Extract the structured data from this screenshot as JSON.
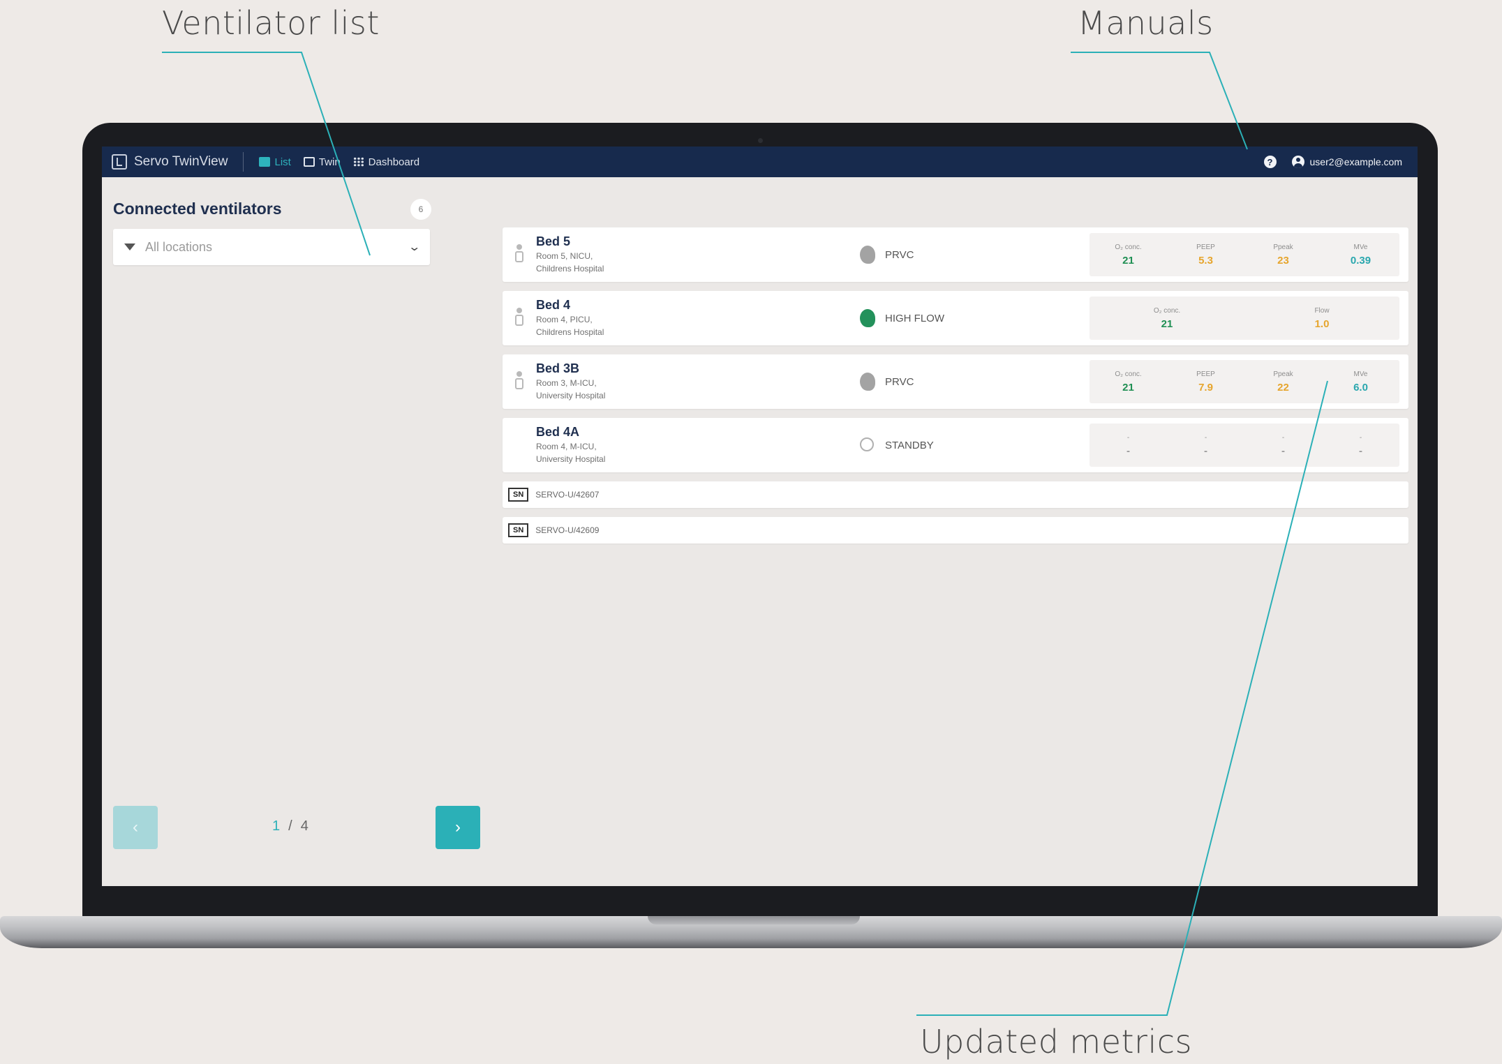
{
  "annotations": {
    "ventilator_list": "Ventilator list",
    "manuals": "Manuals",
    "updated_metrics": "Updated metrics"
  },
  "topbar": {
    "app_name": "Servo TwinView",
    "nav": [
      {
        "label": "List",
        "icon": "list-icon",
        "active": true
      },
      {
        "label": "Twin",
        "icon": "twin-icon",
        "active": false
      },
      {
        "label": "Dashboard",
        "icon": "dashboard-icon",
        "active": false
      }
    ],
    "help_icon": "help-icon",
    "user_email": "user2@example.com"
  },
  "sidebar": {
    "title": "Connected ventilators",
    "count": "6",
    "location_filter": "All locations",
    "pagination": {
      "prev": "‹",
      "current": "1",
      "separator": "/",
      "total": "4",
      "next": "›"
    }
  },
  "ventilators": [
    {
      "bed": "Bed 5",
      "room": "Room 5, NICU,",
      "hospital": "Childrens Hospital",
      "mode": "PRVC",
      "mode_icon": "neonate-head-icon",
      "mode_color": "gray",
      "metrics": [
        {
          "label": "O₂ conc.",
          "value": "21",
          "color": "green"
        },
        {
          "label": "PEEP",
          "value": "5.3",
          "color": "orange"
        },
        {
          "label": "Ppeak",
          "value": "23",
          "color": "orange"
        },
        {
          "label": "MVe",
          "value": "0.39",
          "color": "teal"
        }
      ]
    },
    {
      "bed": "Bed 4",
      "room": "Room 4, PICU,",
      "hospital": "Childrens Hospital",
      "mode": "HIGH FLOW",
      "mode_icon": "child-head-icon",
      "mode_color": "green",
      "metrics": [
        {
          "label": "O₂ conc.",
          "value": "21",
          "color": "green"
        },
        {
          "label": "Flow",
          "value": "1.0",
          "color": "orange"
        }
      ]
    },
    {
      "bed": "Bed 3B",
      "room": "Room 3, M-ICU,",
      "hospital": "University Hospital",
      "mode": "PRVC",
      "mode_icon": "adult-head-icon",
      "mode_color": "gray",
      "metrics": [
        {
          "label": "O₂ conc.",
          "value": "21",
          "color": "green"
        },
        {
          "label": "PEEP",
          "value": "7.9",
          "color": "orange"
        },
        {
          "label": "Ppeak",
          "value": "22",
          "color": "orange"
        },
        {
          "label": "MVe",
          "value": "6.0",
          "color": "teal"
        }
      ]
    },
    {
      "bed": "Bed 4A",
      "room": "Room 4, M-ICU,",
      "hospital": "University Hospital",
      "mode": "STANDBY",
      "mode_icon": "power-icon",
      "mode_color": "power",
      "metrics": [
        {
          "label": "-",
          "value": "-",
          "color": "gray"
        },
        {
          "label": "-",
          "value": "-",
          "color": "gray"
        },
        {
          "label": "-",
          "value": "-",
          "color": "gray"
        },
        {
          "label": "-",
          "value": "-",
          "color": "gray"
        }
      ]
    }
  ],
  "serial_devices": [
    {
      "badge": "SN",
      "serial": "SERVO-U/42607"
    },
    {
      "badge": "SN",
      "serial": "SERVO-U/42609"
    }
  ],
  "colors": {
    "navy": "#172a4d",
    "teal": "#2bb0b7",
    "green": "#1f8f53",
    "orange": "#e6a52d",
    "background": "#eeeae7"
  }
}
